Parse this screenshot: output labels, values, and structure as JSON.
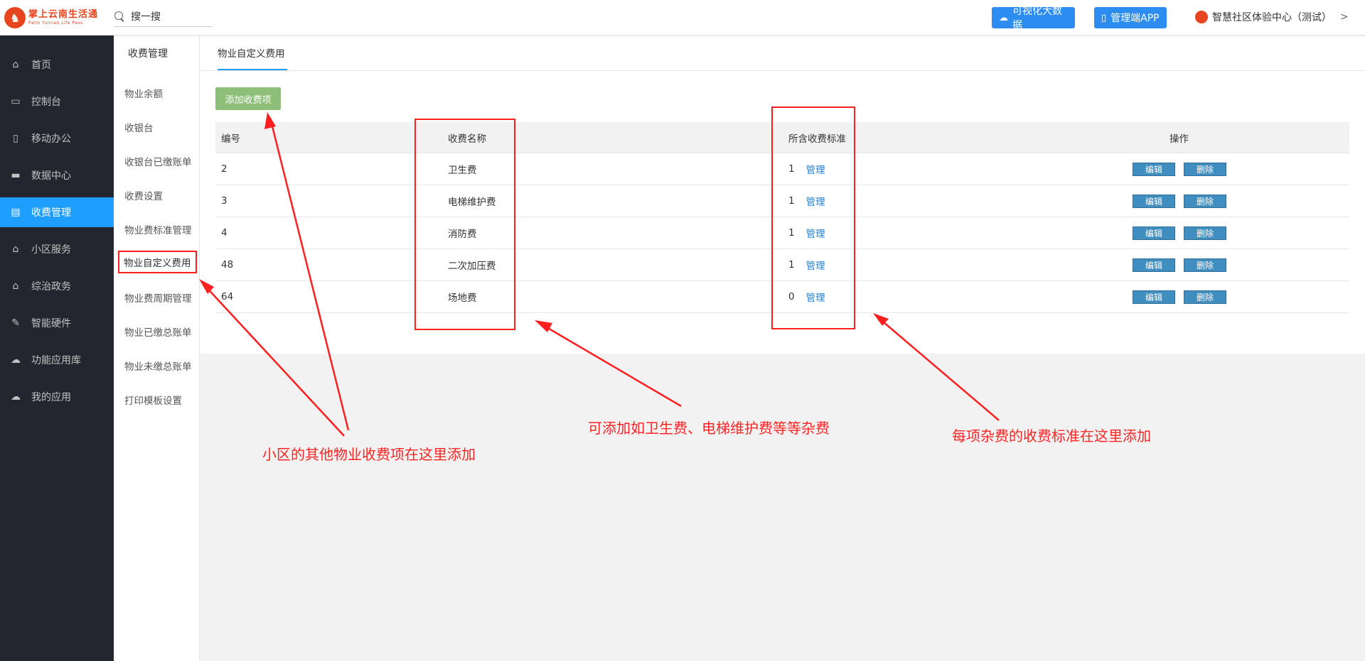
{
  "brand": {
    "name_cn": "掌上云南生活通",
    "name_en": "Palm Yunnan Life Pass"
  },
  "search": {
    "text": "搜一搜"
  },
  "header": {
    "bigdata_label": "可视化大数据",
    "admin_app_label": "管理端APP",
    "community_label": "智慧社区体验中心（测试）",
    "chevron": ">"
  },
  "sidenav": {
    "items": [
      {
        "label": "首页",
        "icon": "home-icon",
        "glyph": "⌂"
      },
      {
        "label": "控制台",
        "icon": "laptop-icon",
        "glyph": "▭"
      },
      {
        "label": "移动办公",
        "icon": "tablet-icon",
        "glyph": "▯"
      },
      {
        "label": "数据中心",
        "icon": "briefcase-icon",
        "glyph": "▬"
      },
      {
        "label": "收费管理",
        "icon": "credit-card-icon",
        "glyph": "▤"
      },
      {
        "label": "小区服务",
        "icon": "home-icon",
        "glyph": "⌂"
      },
      {
        "label": "综治政务",
        "icon": "bank-icon",
        "glyph": "⌂"
      },
      {
        "label": "智能硬件",
        "icon": "wrench-icon",
        "glyph": "✎"
      },
      {
        "label": "功能应用库",
        "icon": "cloud-download-icon",
        "glyph": "☁"
      },
      {
        "label": "我的应用",
        "icon": "cloud-icon",
        "glyph": "☁"
      }
    ],
    "active_index": 4
  },
  "subnav": {
    "title": "收费管理",
    "items": [
      "物业余额",
      "收银台",
      "收银台已缴账单",
      "收费设置",
      "物业费标准管理",
      "物业自定义费用",
      "物业费周期管理",
      "物业已缴总账单",
      "物业未缴总账单",
      "打印模板设置"
    ],
    "active_index": 5
  },
  "main": {
    "tab_label": "物业自定义费用",
    "add_button": "添加收费项",
    "table": {
      "headers": {
        "id": "编号",
        "name": "收费名称",
        "standards": "所含收费标准",
        "ops": "操作"
      },
      "rows": [
        {
          "id": "2",
          "name": "卫生费",
          "count": "1",
          "manage": "管理",
          "edit": "编辑",
          "delete": "删除"
        },
        {
          "id": "3",
          "name": "电梯维护费",
          "count": "1",
          "manage": "管理",
          "edit": "编辑",
          "delete": "删除"
        },
        {
          "id": "4",
          "name": "消防费",
          "count": "1",
          "manage": "管理",
          "edit": "编辑",
          "delete": "删除"
        },
        {
          "id": "48",
          "name": "二次加压费",
          "count": "1",
          "manage": "管理",
          "edit": "编辑",
          "delete": "删除"
        },
        {
          "id": "64",
          "name": "场地费",
          "count": "0",
          "manage": "管理",
          "edit": "编辑",
          "delete": "删除"
        }
      ]
    }
  },
  "annotations": {
    "left": "小区的其他物业收费项在这里添加",
    "middle": "可添加如卫生费、电梯维护费等等杂费",
    "right": "每项杂费的收费标准在这里添加"
  },
  "colors": {
    "accent": "#1e9fff",
    "annotation": "#ff1f1f",
    "add_button": "#8dbf78",
    "nav_bg": "#23262e"
  }
}
